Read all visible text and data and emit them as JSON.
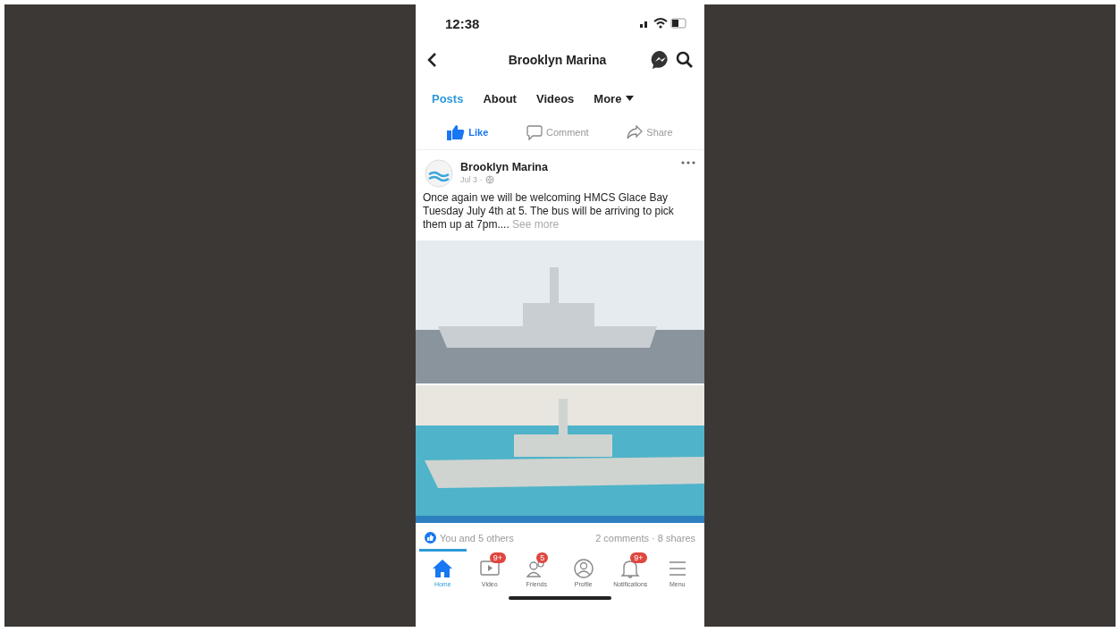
{
  "status_bar": {
    "time": "12:38"
  },
  "header": {
    "title": "Brooklyn Marina"
  },
  "tabs": [
    {
      "label": "Posts",
      "selected": true
    },
    {
      "label": "About",
      "selected": false
    },
    {
      "label": "Videos",
      "selected": false
    },
    {
      "label": "More",
      "selected": false
    }
  ],
  "actions": [
    {
      "kind": "like",
      "label": "Like"
    },
    {
      "kind": "comment",
      "label": "Comment"
    },
    {
      "kind": "share",
      "label": "Share"
    }
  ],
  "post": {
    "author": "Brooklyn Marina",
    "date": "Jul 3 ·",
    "text": "Once again we will be welcoming HMCS Glace Bay Tuesday July 4th at 5. The bus will  be arriving to pick them up at 7pm....",
    "see_more": "See more",
    "reactions": "You and 5 others",
    "stats": "2 comments · 8 shares"
  },
  "bottom_nav": [
    {
      "kind": "home",
      "label": "Home",
      "selected": true
    },
    {
      "kind": "video",
      "label": "Video",
      "badge": "9+",
      "selected": false
    },
    {
      "kind": "friends",
      "label": "Friends",
      "badge": "5",
      "selected": false
    },
    {
      "kind": "profile",
      "label": "Profile",
      "selected": false
    },
    {
      "kind": "bell",
      "label": "Notifications",
      "badge": "9+",
      "selected": false
    },
    {
      "kind": "menu",
      "label": "Menu",
      "selected": false
    }
  ]
}
